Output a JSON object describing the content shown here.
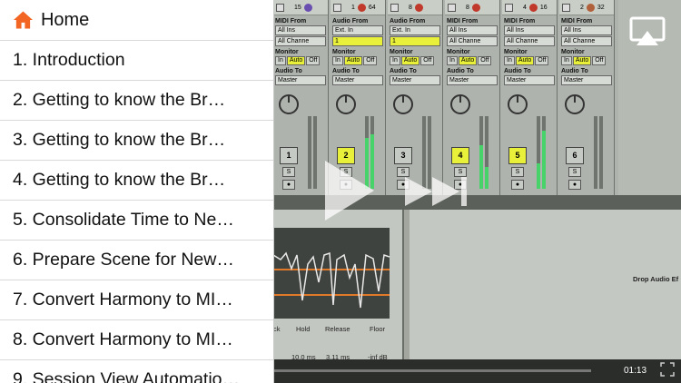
{
  "sidebar": {
    "home_label": "Home",
    "items": [
      {
        "label": "1. Introduction"
      },
      {
        "label": "2. Getting to know the Br…"
      },
      {
        "label": "3. Getting to know the Br…"
      },
      {
        "label": "4. Getting to know the Br…"
      },
      {
        "label": "5. Consolidate Time to Ne…"
      },
      {
        "label": "6. Prepare Scene for New…"
      },
      {
        "label": "7. Convert Harmony to MI…"
      },
      {
        "label": "8. Convert Harmony to MI…"
      },
      {
        "label": "9. Session View Automatio…"
      }
    ],
    "accent": "#f26522"
  },
  "video": {
    "time": "01:13",
    "drop_label": "Drop Audio Ef",
    "tracks": [
      {
        "num": "1",
        "badge": "15",
        "ball": "#6a4fb0",
        "from": "MIDI From",
        "src": "All Ins",
        "chan": "All Channe",
        "active": false
      },
      {
        "num": "2",
        "badge": "64",
        "ball": "#c0392b",
        "from": "Audio From",
        "src": "Ext. In",
        "chan": "1",
        "active": true
      },
      {
        "num": "3",
        "badge": "8",
        "ball": "#c0392b",
        "from": "Audio From",
        "src": "Ext. In",
        "chan": "1",
        "active": false
      },
      {
        "num": "4",
        "badge": "8",
        "ball": "#c0392b",
        "from": "MIDI From",
        "src": "All Ins",
        "chan": "All Channe",
        "active": true
      },
      {
        "num": "5",
        "badge": "16",
        "ball": "#c0392b",
        "from": "MIDI From",
        "src": "All Ins",
        "chan": "All Channe",
        "active": true
      },
      {
        "num": "6",
        "badge": "32",
        "ball": "#b0603a",
        "from": "MIDI From",
        "src": "All Ins",
        "chan": "All Channe",
        "active": false
      }
    ],
    "monitor_label": "Monitor",
    "audio_to_label": "Audio To",
    "master_label": "Master",
    "mon_in": "In",
    "mon_auto": "Auto",
    "mon_off": "Off",
    "controls": {
      "ck": "ck",
      "hold": "Hold",
      "hold_val": "10.0 ms",
      "release": "Release",
      "release_val": "3.11 ms",
      "floor": "Floor",
      "floor_val": "-inf dB"
    }
  }
}
